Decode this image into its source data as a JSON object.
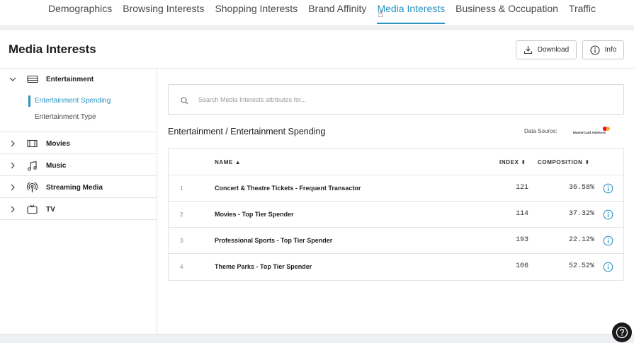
{
  "topnav": {
    "tabs": [
      {
        "label": "Demographics"
      },
      {
        "label": "Browsing Interests"
      },
      {
        "label": "Shopping Interests"
      },
      {
        "label": "Brand Affinity"
      },
      {
        "label": "Media Interests",
        "active": true
      },
      {
        "label": "Business & Occupation"
      },
      {
        "label": "Traffic"
      }
    ]
  },
  "header": {
    "title": "Media Interests",
    "download_label": "Download",
    "info_label": "Info"
  },
  "sidebar": {
    "categories": [
      {
        "label": "Entertainment",
        "icon": "ticket-icon",
        "expanded": true,
        "subs": [
          {
            "label": "Entertainment Spending",
            "active": true
          },
          {
            "label": "Entertainment Type"
          }
        ]
      },
      {
        "label": "Movies",
        "icon": "film-icon"
      },
      {
        "label": "Music",
        "icon": "music-note-icon"
      },
      {
        "label": "Streaming Media",
        "icon": "podcast-icon"
      },
      {
        "label": "TV",
        "icon": "tv-icon"
      }
    ]
  },
  "search": {
    "placeholder": "Search Media Interests attributes for...",
    "value": ""
  },
  "section": {
    "title": "Entertainment / Entertainment Spending",
    "data_source_label": "Data Source:",
    "data_source_logo_text": "MasterCard Advisors"
  },
  "table": {
    "columns": {
      "name": "NAME",
      "index": "INDEX",
      "composition": "COMPOSITION"
    },
    "sort": {
      "column": "name",
      "direction": "asc"
    },
    "rows": [
      {
        "num": "1",
        "name": "Concert & Theatre Tickets - Frequent Transactor",
        "index": "121",
        "composition": "36.58%"
      },
      {
        "num": "2",
        "name": "Movies - Top Tier Spender",
        "index": "114",
        "composition": "37.32%"
      },
      {
        "num": "3",
        "name": "Professional Sports - Top Tier Spender",
        "index": "193",
        "composition": "22.12%"
      },
      {
        "num": "4",
        "name": "Theme Parks - Top Tier Spender",
        "index": "106",
        "composition": "52.52%"
      }
    ]
  },
  "colors": {
    "accent": "#2a93c3",
    "text": "#1d1d1f",
    "border": "#e3e4e7"
  }
}
